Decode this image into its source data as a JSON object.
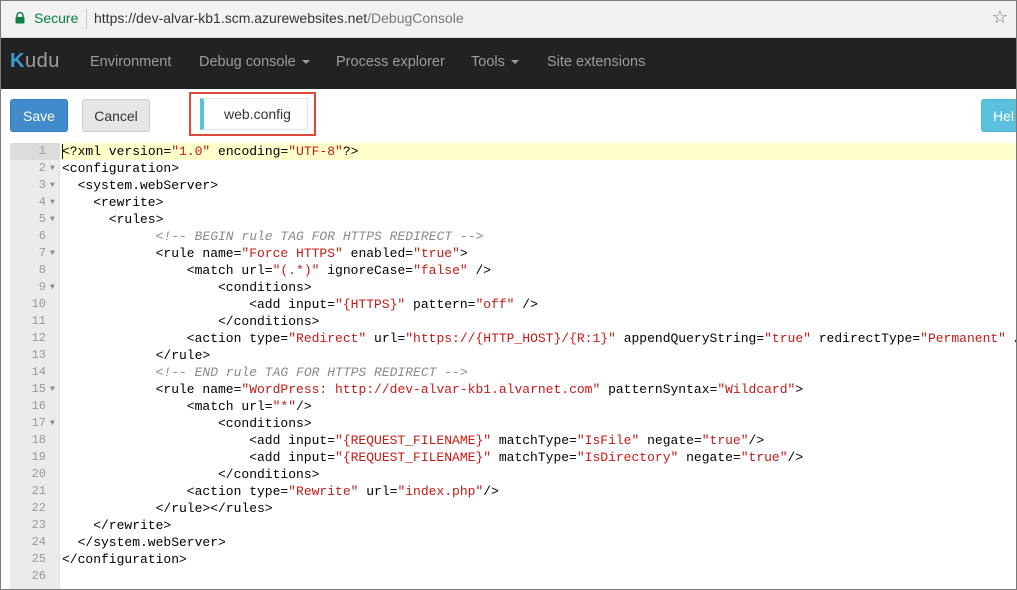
{
  "browser": {
    "secure_label": "Secure",
    "url_base": "https://dev-alvar-kb1.scm.azurewebsites.net",
    "url_path": "/DebugConsole"
  },
  "nav": {
    "brand_first": "K",
    "brand_rest": "udu",
    "items": [
      "Environment",
      "Debug console",
      "Process explorer",
      "Tools",
      "Site extensions"
    ]
  },
  "toolbar": {
    "save_label": "Save",
    "cancel_label": "Cancel",
    "file_name": "web.config",
    "help_label": "Hel"
  },
  "colors": {
    "accent_save": "#428bca",
    "accent_tab": "#5bc0de",
    "highlight_box": "#e0483e",
    "nav_bg": "#222222",
    "string_value": "#c41a16",
    "comment": "#8a8a8a"
  },
  "editor": {
    "active_line": 1,
    "lines": [
      {
        "n": "1",
        "indent": 0,
        "fold": false,
        "tokens": [
          [
            "t",
            "<?xml version="
          ],
          [
            "v",
            "\"1.0\""
          ],
          [
            "t",
            " encoding="
          ],
          [
            "v",
            "\"UTF-8\""
          ],
          [
            "t",
            "?>"
          ]
        ]
      },
      {
        "n": "2",
        "indent": 0,
        "fold": true,
        "tokens": [
          [
            "t",
            "<configuration>"
          ]
        ]
      },
      {
        "n": "3",
        "indent": 2,
        "fold": true,
        "tokens": [
          [
            "t",
            "<system.webServer>"
          ]
        ]
      },
      {
        "n": "4",
        "indent": 4,
        "fold": true,
        "tokens": [
          [
            "t",
            "<rewrite>"
          ]
        ]
      },
      {
        "n": "5",
        "indent": 6,
        "fold": true,
        "tokens": [
          [
            "t",
            "<rules>"
          ]
        ]
      },
      {
        "n": "6",
        "indent": 12,
        "fold": false,
        "tokens": [
          [
            "c",
            "<!-- BEGIN rule TAG FOR HTTPS REDIRECT -->"
          ]
        ]
      },
      {
        "n": "7",
        "indent": 12,
        "fold": true,
        "tokens": [
          [
            "t",
            "<rule name="
          ],
          [
            "v",
            "\"Force HTTPS\""
          ],
          [
            "t",
            " enabled="
          ],
          [
            "v",
            "\"true\""
          ],
          [
            "t",
            ">"
          ]
        ]
      },
      {
        "n": "8",
        "indent": 16,
        "fold": false,
        "tokens": [
          [
            "t",
            "<match url="
          ],
          [
            "v",
            "\"(.*)\""
          ],
          [
            "t",
            " ignoreCase="
          ],
          [
            "v",
            "\"false\""
          ],
          [
            "t",
            " />"
          ]
        ]
      },
      {
        "n": "9",
        "indent": 20,
        "fold": true,
        "tokens": [
          [
            "t",
            "<conditions>"
          ]
        ]
      },
      {
        "n": "10",
        "indent": 24,
        "fold": false,
        "tokens": [
          [
            "t",
            "<add input="
          ],
          [
            "v",
            "\"{HTTPS}\""
          ],
          [
            "t",
            " pattern="
          ],
          [
            "v",
            "\"off\""
          ],
          [
            "t",
            " />"
          ]
        ]
      },
      {
        "n": "11",
        "indent": 20,
        "fold": false,
        "tokens": [
          [
            "t",
            "</conditions>"
          ]
        ]
      },
      {
        "n": "12",
        "indent": 16,
        "fold": false,
        "tokens": [
          [
            "t",
            "<action type="
          ],
          [
            "v",
            "\"Redirect\""
          ],
          [
            "t",
            " url="
          ],
          [
            "v",
            "\"https://{HTTP_HOST}/{R:1}\""
          ],
          [
            "t",
            " appendQueryString="
          ],
          [
            "v",
            "\"true\""
          ],
          [
            "t",
            " redirectType="
          ],
          [
            "v",
            "\"Permanent\""
          ],
          [
            "t",
            " />"
          ]
        ]
      },
      {
        "n": "13",
        "indent": 12,
        "fold": false,
        "tokens": [
          [
            "t",
            "</rule>"
          ]
        ]
      },
      {
        "n": "14",
        "indent": 12,
        "fold": false,
        "tokens": [
          [
            "c",
            "<!-- END rule TAG FOR HTTPS REDIRECT -->"
          ]
        ]
      },
      {
        "n": "15",
        "indent": 12,
        "fold": true,
        "tokens": [
          [
            "t",
            "<rule name="
          ],
          [
            "v",
            "\"WordPress: http://dev-alvar-kb1.alvarnet.com\""
          ],
          [
            "t",
            " patternSyntax="
          ],
          [
            "v",
            "\"Wildcard\""
          ],
          [
            "t",
            ">"
          ]
        ]
      },
      {
        "n": "16",
        "indent": 16,
        "fold": false,
        "tokens": [
          [
            "t",
            "<match url="
          ],
          [
            "v",
            "\"*\""
          ],
          [
            "t",
            "/>"
          ]
        ]
      },
      {
        "n": "17",
        "indent": 20,
        "fold": true,
        "tokens": [
          [
            "t",
            "<conditions>"
          ]
        ]
      },
      {
        "n": "18",
        "indent": 24,
        "fold": false,
        "tokens": [
          [
            "t",
            "<add input="
          ],
          [
            "v",
            "\"{REQUEST_FILENAME}\""
          ],
          [
            "t",
            " matchType="
          ],
          [
            "v",
            "\"IsFile\""
          ],
          [
            "t",
            " negate="
          ],
          [
            "v",
            "\"true\""
          ],
          [
            "t",
            "/>"
          ]
        ]
      },
      {
        "n": "19",
        "indent": 24,
        "fold": false,
        "tokens": [
          [
            "t",
            "<add input="
          ],
          [
            "v",
            "\"{REQUEST_FILENAME}\""
          ],
          [
            "t",
            " matchType="
          ],
          [
            "v",
            "\"IsDirectory\""
          ],
          [
            "t",
            " negate="
          ],
          [
            "v",
            "\"true\""
          ],
          [
            "t",
            "/>"
          ]
        ]
      },
      {
        "n": "20",
        "indent": 20,
        "fold": false,
        "tokens": [
          [
            "t",
            "</conditions>"
          ]
        ]
      },
      {
        "n": "21",
        "indent": 16,
        "fold": false,
        "tokens": [
          [
            "t",
            "<action type="
          ],
          [
            "v",
            "\"Rewrite\""
          ],
          [
            "t",
            " url="
          ],
          [
            "v",
            "\"index.php\""
          ],
          [
            "t",
            "/>"
          ]
        ]
      },
      {
        "n": "22",
        "indent": 12,
        "fold": false,
        "tokens": [
          [
            "t",
            "</rule></rules>"
          ]
        ]
      },
      {
        "n": "23",
        "indent": 4,
        "fold": false,
        "tokens": [
          [
            "t",
            "</rewrite>"
          ]
        ]
      },
      {
        "n": "24",
        "indent": 2,
        "fold": false,
        "tokens": [
          [
            "t",
            "</system.webServer>"
          ]
        ]
      },
      {
        "n": "25",
        "indent": 0,
        "fold": false,
        "tokens": [
          [
            "t",
            "</configuration>"
          ]
        ]
      },
      {
        "n": "26",
        "indent": 0,
        "fold": false,
        "tokens": []
      }
    ]
  }
}
